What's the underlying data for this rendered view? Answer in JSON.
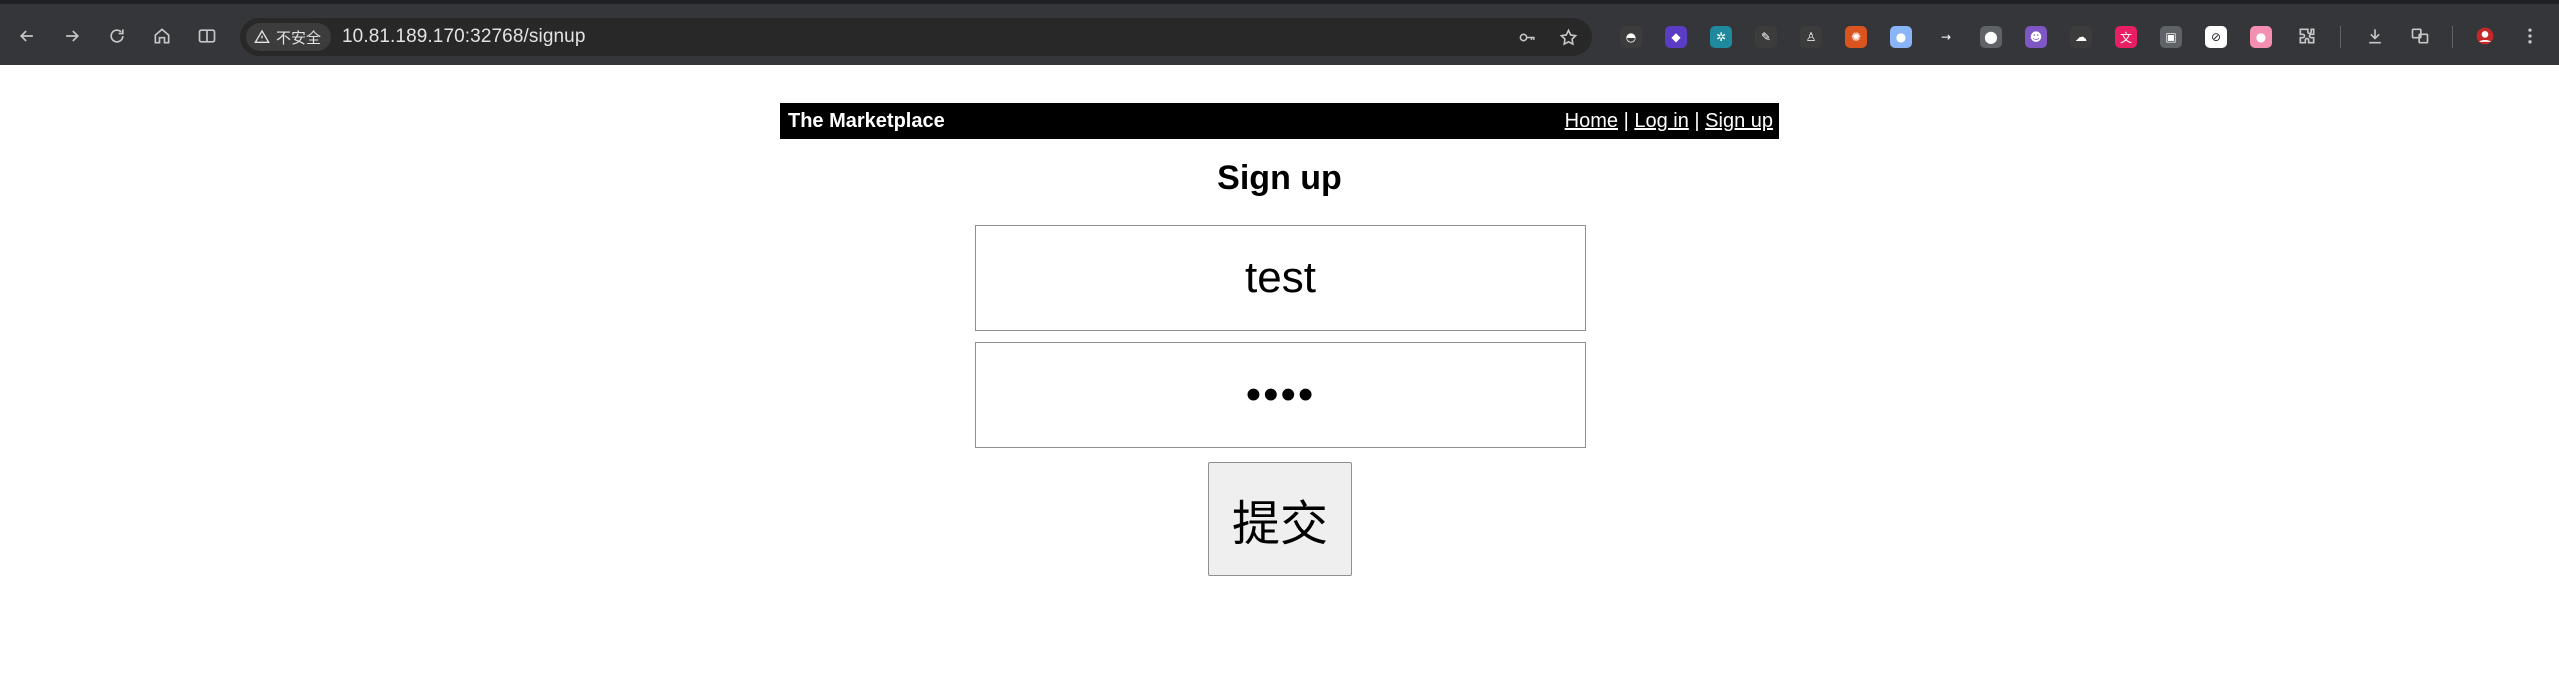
{
  "browser": {
    "security_label": "不安全",
    "url": "10.81.189.170:32768/signup",
    "extensions": [
      {
        "icon": "hat-icon",
        "color": "#3c3c3c",
        "glyph": "◓"
      },
      {
        "icon": "diamond-icon",
        "color": "#5b3cc4",
        "glyph": "◆"
      },
      {
        "icon": "gear-square-icon",
        "color": "#1f8a9e",
        "glyph": "✲"
      },
      {
        "icon": "feather-icon",
        "color": "#3c3c3c",
        "glyph": "✎"
      },
      {
        "icon": "person-icon",
        "color": "#3c3c3c",
        "glyph": "♙"
      },
      {
        "icon": "cookie-icon",
        "color": "#d9541e",
        "glyph": "✺"
      },
      {
        "icon": "circle-icon",
        "color": "#8ab4f8",
        "glyph": "●"
      },
      {
        "icon": "arrow-icon",
        "color": "#35363a",
        "glyph": "→"
      },
      {
        "icon": "badge-icon",
        "color": "#5f6368",
        "glyph": "⬤"
      },
      {
        "icon": "devil-icon",
        "color": "#7e57c2",
        "glyph": "☻"
      },
      {
        "icon": "cloud-icon",
        "color": "#3c3c3c",
        "glyph": "☁"
      },
      {
        "icon": "translate-icon",
        "color": "#e91e63",
        "glyph": "文"
      },
      {
        "icon": "image-icon",
        "color": "#5f6368",
        "glyph": "▣"
      },
      {
        "icon": "block-icon",
        "color": "#ffffff",
        "glyph": "⊘"
      },
      {
        "icon": "dot-icon",
        "color": "#f48fb1",
        "glyph": "●"
      }
    ]
  },
  "header": {
    "title": "The Marketplace",
    "nav": [
      {
        "label": "Home"
      },
      {
        "label": "Log in"
      },
      {
        "label": "Sign up"
      }
    ],
    "separator": "|"
  },
  "form": {
    "heading": "Sign up",
    "username_value": "test",
    "password_value": "test",
    "submit_label": "提交"
  }
}
